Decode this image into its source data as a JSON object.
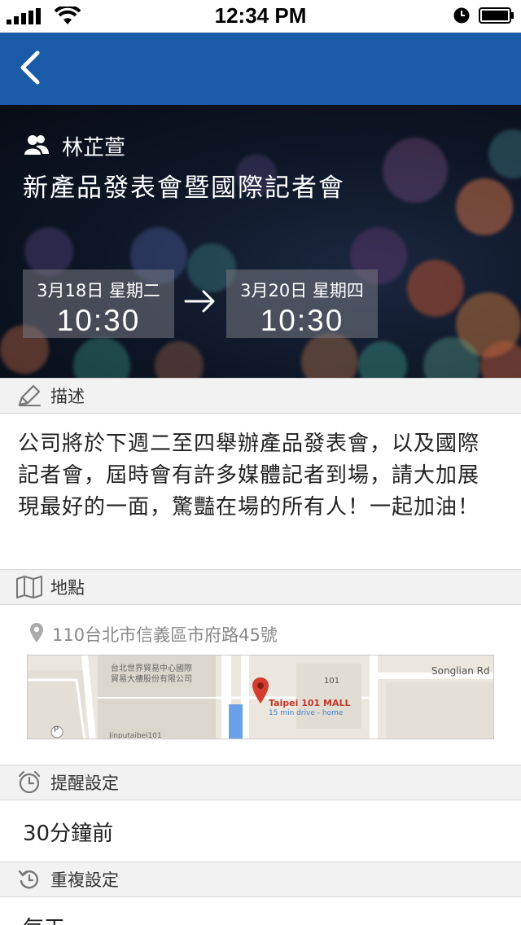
{
  "status_bar": {
    "time": "12:34 PM",
    "icons": [
      "signal-icon",
      "wifi-icon",
      "alarm-clock-icon",
      "battery-icon"
    ]
  },
  "nav": {
    "back_icon": "chevron-left-icon",
    "background": "#1a5ba8"
  },
  "event": {
    "owner": "林芷萱",
    "owner_icon": "people-icon",
    "title": "新產品發表會暨國際記者會",
    "start": {
      "date": "3月18日 星期二",
      "time": "10:30"
    },
    "end": {
      "date": "3月20日 星期四",
      "time": "10:30"
    },
    "arrow_icon": "arrow-right-icon"
  },
  "sections": {
    "description": {
      "label": "描述",
      "icon": "pencil-icon",
      "text": "公司將於下週二至四舉辦產品發表會，以及國際記者會，屆時會有許多媒體記者到場，請大加展現最好的一面，驚豔在場的所有人！一起加油！"
    },
    "location": {
      "label": "地點",
      "icon": "map-icon",
      "address": "110台北市信義區市府路45號",
      "pin_icon": "location-pin-icon",
      "map": {
        "building_label_1": "台北世界貿易中心國際",
        "building_label_2": "貿易大樓股份有限公司",
        "road_label": "Songlian Rd",
        "poi_name": "Taipei 101 MALL",
        "poi_sub": "15 min drive - home",
        "poi_num": "101",
        "parking": "P",
        "street_fragment": "Jinputaibei101"
      }
    },
    "reminder": {
      "label": "提醒設定",
      "icon": "alarm-clock-icon",
      "value": "30分鐘前"
    },
    "repeat": {
      "label": "重複設定",
      "icon": "repeat-icon",
      "value": "每天"
    }
  }
}
